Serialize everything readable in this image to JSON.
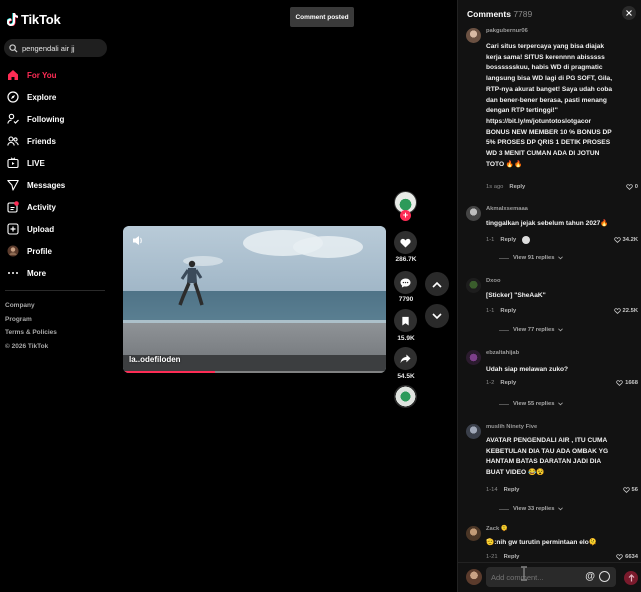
{
  "app": {
    "name": "TikTok",
    "accent": "#fe2c55"
  },
  "search": {
    "value": "pengendali air jj"
  },
  "nav": [
    {
      "label": "For You",
      "icon": "home-icon",
      "active": true
    },
    {
      "label": "Explore",
      "icon": "compass-icon"
    },
    {
      "label": "Following",
      "icon": "following-icon"
    },
    {
      "label": "Friends",
      "icon": "friends-icon"
    },
    {
      "label": "LIVE",
      "icon": "live-icon"
    },
    {
      "label": "Messages",
      "icon": "messages-icon"
    },
    {
      "label": "Activity",
      "icon": "activity-icon"
    },
    {
      "label": "Upload",
      "icon": "upload-icon"
    },
    {
      "label": "Profile",
      "icon": "profile-icon"
    },
    {
      "label": "More",
      "icon": "more-icon"
    }
  ],
  "footer": [
    "Company",
    "Program",
    "Terms & Policies",
    "© 2026 TikTok"
  ],
  "toast": "Comment posted",
  "video": {
    "caption": "la..odefiloden",
    "progress": 0.35
  },
  "actions": {
    "likes": "286.7K",
    "comments": "7790",
    "saves": "15.9K",
    "shares": "54.5K"
  },
  "comments_panel": {
    "title": "Comments",
    "count": "7789",
    "compose_placeholder": "Add comment...",
    "comments": [
      {
        "user": "pakgubernur06",
        "lines": [
          "Cari situs terpercaya yang bisa diajak",
          "kerja sama! SITUS kerennnn abisssss",
          "bosssssskuu, habis WD di pragmatic",
          "langsung bisa WD lagi di PG SOFT, Gila,",
          "RTP-nya akurat banget! Saya udah coba",
          "dan bener-bener berasa, pasti menang",
          "dengan RTP tertinggi!\"",
          "https://bit.ly/m/jotuntotoslotgacor",
          "BONUS NEW MEMBER 10 % BONUS DP",
          "5% PROSES DP QRIS 1 DETIK PROSES",
          "WD 3 MENIT CUMAN ADA DI JOTUN",
          "TOTO 🔥🔥"
        ],
        "time": "1s ago",
        "reply": "Reply",
        "likes": "0"
      },
      {
        "user": "Akmalxsemaaa",
        "lines": [
          "tinggalkan jejak sebelum tahun 2027🔥"
        ],
        "time": "1-1",
        "reply": "Reply",
        "likes": "34.2K",
        "views": "View 91 replies"
      },
      {
        "user": "Dxoo",
        "lines": [
          "[Sticker] \"SheAaK\""
        ],
        "time": "1-1",
        "reply": "Reply",
        "likes": "22.5K",
        "views": "View 77 replies"
      },
      {
        "user": "ebzaltahijab",
        "lines": [
          "Udah siap melawan zuko?"
        ],
        "time": "1-2",
        "reply": "Reply",
        "likes": "1668",
        "views": "View 55 replies"
      },
      {
        "user": "muslih Ninety Five",
        "lines": [
          "AVATAR PENGENDALI AIR , ITU CUMA",
          "KEBETULAN DIA TAU ADA OMBAK YG",
          "HANTAM BATAS DARATAN JADI DIA",
          "BUAT VIDEO 😂😵"
        ],
        "time": "1-14",
        "reply": "Reply",
        "likes": "56",
        "views": "View 33 replies"
      },
      {
        "user": "Zack 🫠",
        "lines": [
          "🫡:nih gw turutin permintaan elo🫠"
        ],
        "time": "1-21",
        "reply": "Reply",
        "likes": "6634"
      }
    ]
  }
}
